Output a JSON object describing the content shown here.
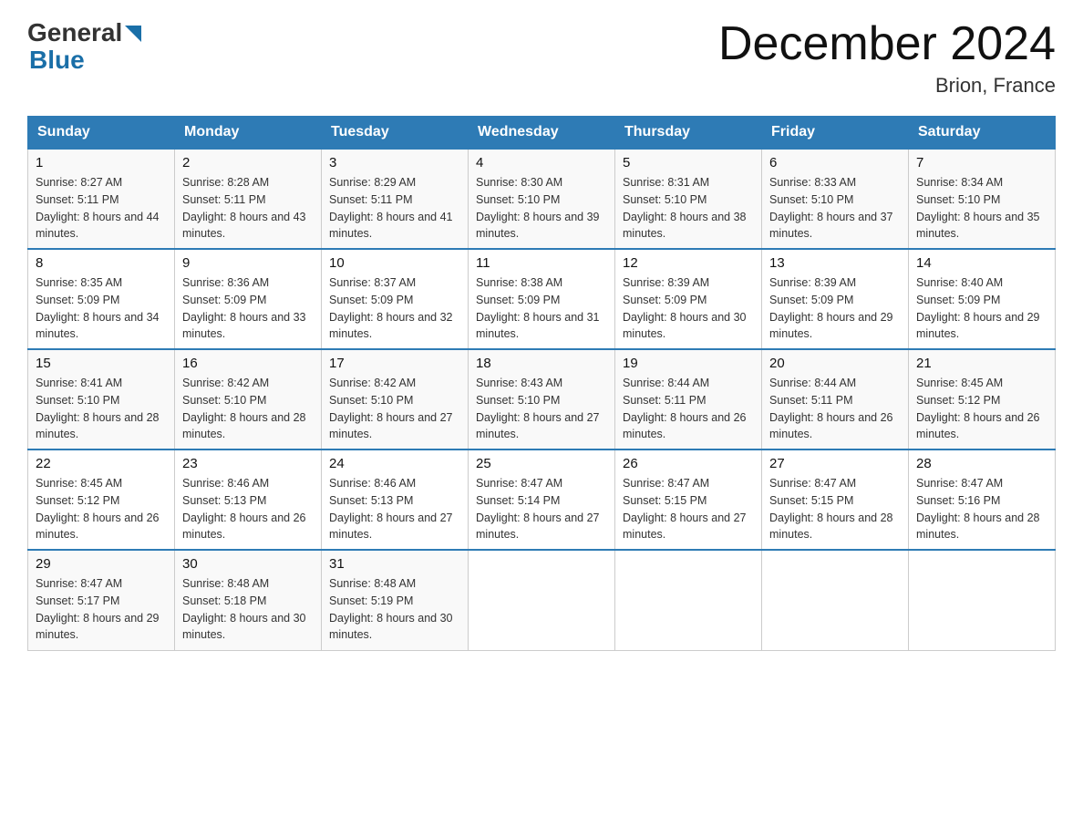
{
  "header": {
    "logo_general": "General",
    "logo_blue": "Blue",
    "month_title": "December 2024",
    "location": "Brion, France"
  },
  "columns": [
    "Sunday",
    "Monday",
    "Tuesday",
    "Wednesday",
    "Thursday",
    "Friday",
    "Saturday"
  ],
  "weeks": [
    [
      {
        "day": "1",
        "sunrise": "8:27 AM",
        "sunset": "5:11 PM",
        "daylight": "8 hours and 44 minutes."
      },
      {
        "day": "2",
        "sunrise": "8:28 AM",
        "sunset": "5:11 PM",
        "daylight": "8 hours and 43 minutes."
      },
      {
        "day": "3",
        "sunrise": "8:29 AM",
        "sunset": "5:11 PM",
        "daylight": "8 hours and 41 minutes."
      },
      {
        "day": "4",
        "sunrise": "8:30 AM",
        "sunset": "5:10 PM",
        "daylight": "8 hours and 39 minutes."
      },
      {
        "day": "5",
        "sunrise": "8:31 AM",
        "sunset": "5:10 PM",
        "daylight": "8 hours and 38 minutes."
      },
      {
        "day": "6",
        "sunrise": "8:33 AM",
        "sunset": "5:10 PM",
        "daylight": "8 hours and 37 minutes."
      },
      {
        "day": "7",
        "sunrise": "8:34 AM",
        "sunset": "5:10 PM",
        "daylight": "8 hours and 35 minutes."
      }
    ],
    [
      {
        "day": "8",
        "sunrise": "8:35 AM",
        "sunset": "5:09 PM",
        "daylight": "8 hours and 34 minutes."
      },
      {
        "day": "9",
        "sunrise": "8:36 AM",
        "sunset": "5:09 PM",
        "daylight": "8 hours and 33 minutes."
      },
      {
        "day": "10",
        "sunrise": "8:37 AM",
        "sunset": "5:09 PM",
        "daylight": "8 hours and 32 minutes."
      },
      {
        "day": "11",
        "sunrise": "8:38 AM",
        "sunset": "5:09 PM",
        "daylight": "8 hours and 31 minutes."
      },
      {
        "day": "12",
        "sunrise": "8:39 AM",
        "sunset": "5:09 PM",
        "daylight": "8 hours and 30 minutes."
      },
      {
        "day": "13",
        "sunrise": "8:39 AM",
        "sunset": "5:09 PM",
        "daylight": "8 hours and 29 minutes."
      },
      {
        "day": "14",
        "sunrise": "8:40 AM",
        "sunset": "5:09 PM",
        "daylight": "8 hours and 29 minutes."
      }
    ],
    [
      {
        "day": "15",
        "sunrise": "8:41 AM",
        "sunset": "5:10 PM",
        "daylight": "8 hours and 28 minutes."
      },
      {
        "day": "16",
        "sunrise": "8:42 AM",
        "sunset": "5:10 PM",
        "daylight": "8 hours and 28 minutes."
      },
      {
        "day": "17",
        "sunrise": "8:42 AM",
        "sunset": "5:10 PM",
        "daylight": "8 hours and 27 minutes."
      },
      {
        "day": "18",
        "sunrise": "8:43 AM",
        "sunset": "5:10 PM",
        "daylight": "8 hours and 27 minutes."
      },
      {
        "day": "19",
        "sunrise": "8:44 AM",
        "sunset": "5:11 PM",
        "daylight": "8 hours and 26 minutes."
      },
      {
        "day": "20",
        "sunrise": "8:44 AM",
        "sunset": "5:11 PM",
        "daylight": "8 hours and 26 minutes."
      },
      {
        "day": "21",
        "sunrise": "8:45 AM",
        "sunset": "5:12 PM",
        "daylight": "8 hours and 26 minutes."
      }
    ],
    [
      {
        "day": "22",
        "sunrise": "8:45 AM",
        "sunset": "5:12 PM",
        "daylight": "8 hours and 26 minutes."
      },
      {
        "day": "23",
        "sunrise": "8:46 AM",
        "sunset": "5:13 PM",
        "daylight": "8 hours and 26 minutes."
      },
      {
        "day": "24",
        "sunrise": "8:46 AM",
        "sunset": "5:13 PM",
        "daylight": "8 hours and 27 minutes."
      },
      {
        "day": "25",
        "sunrise": "8:47 AM",
        "sunset": "5:14 PM",
        "daylight": "8 hours and 27 minutes."
      },
      {
        "day": "26",
        "sunrise": "8:47 AM",
        "sunset": "5:15 PM",
        "daylight": "8 hours and 27 minutes."
      },
      {
        "day": "27",
        "sunrise": "8:47 AM",
        "sunset": "5:15 PM",
        "daylight": "8 hours and 28 minutes."
      },
      {
        "day": "28",
        "sunrise": "8:47 AM",
        "sunset": "5:16 PM",
        "daylight": "8 hours and 28 minutes."
      }
    ],
    [
      {
        "day": "29",
        "sunrise": "8:47 AM",
        "sunset": "5:17 PM",
        "daylight": "8 hours and 29 minutes."
      },
      {
        "day": "30",
        "sunrise": "8:48 AM",
        "sunset": "5:18 PM",
        "daylight": "8 hours and 30 minutes."
      },
      {
        "day": "31",
        "sunrise": "8:48 AM",
        "sunset": "5:19 PM",
        "daylight": "8 hours and 30 minutes."
      },
      null,
      null,
      null,
      null
    ]
  ]
}
